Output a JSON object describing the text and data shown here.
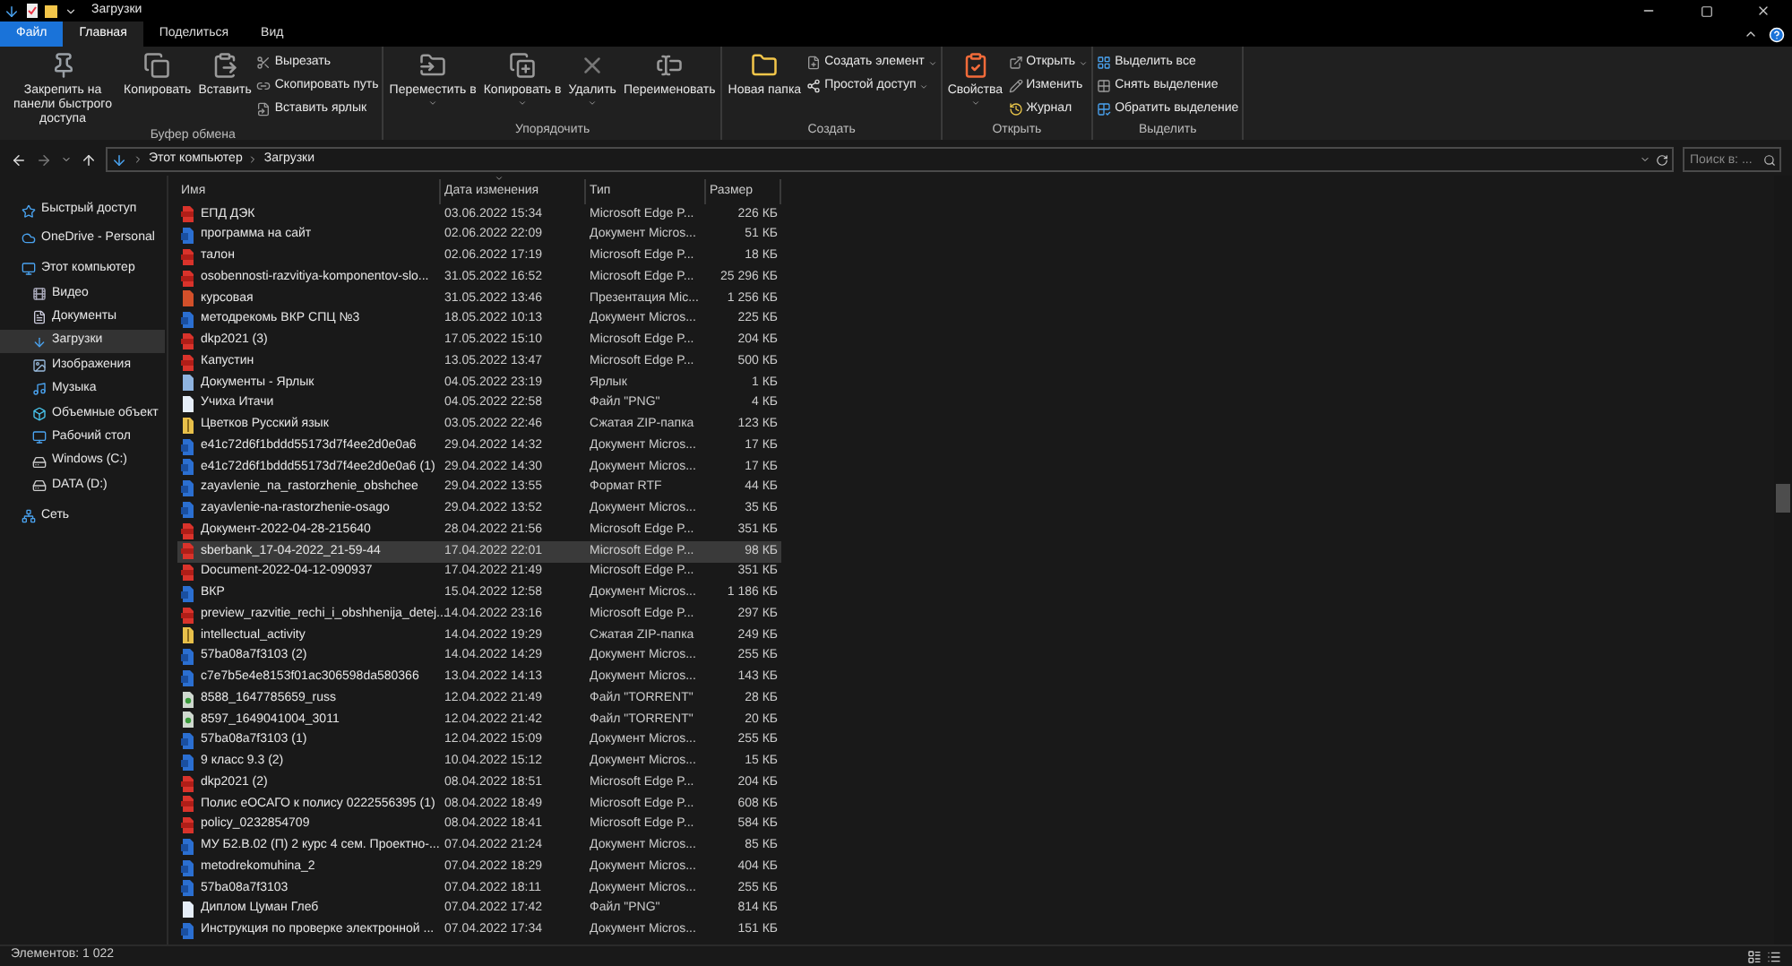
{
  "window": {
    "title": "Загрузки"
  },
  "tabs": [
    {
      "label": "Файл",
      "kind": "file",
      "selected": false
    },
    {
      "label": "Главная",
      "kind": "tab",
      "selected": true
    },
    {
      "label": "Поделиться",
      "kind": "tab",
      "selected": false
    },
    {
      "label": "Вид",
      "kind": "tab",
      "selected": false
    }
  ],
  "ribbon": [
    {
      "label": "Буфер обмена",
      "items": [
        {
          "kind": "large",
          "label": "Закрепить на панели быстрого доступа"
        },
        {
          "kind": "large",
          "label": "Копировать"
        },
        {
          "kind": "large",
          "label": "Вставить"
        },
        {
          "kind": "small",
          "label": "Вырезать"
        },
        {
          "kind": "small",
          "label": "Скопировать путь"
        },
        {
          "kind": "small",
          "label": "Вставить ярлык"
        }
      ]
    },
    {
      "label": "Упорядочить",
      "items": [
        {
          "kind": "large",
          "label": "Переместить в",
          "caret": true
        },
        {
          "kind": "large",
          "label": "Копировать в",
          "caret": true
        },
        {
          "kind": "large",
          "label": "Удалить",
          "caret": true
        },
        {
          "kind": "large",
          "label": "Переименовать"
        }
      ]
    },
    {
      "label": "Создать",
      "items": [
        {
          "kind": "large",
          "label": "Новая папка"
        },
        {
          "kind": "small",
          "label": "Создать элемент",
          "caret": true
        },
        {
          "kind": "small",
          "label": "Простой доступ",
          "caret": true
        }
      ]
    },
    {
      "label": "Открыть",
      "items": [
        {
          "kind": "large",
          "label": "Свойства",
          "caret": true
        },
        {
          "kind": "small",
          "label": "Открыть",
          "caret": true
        },
        {
          "kind": "small",
          "label": "Изменить"
        },
        {
          "kind": "small",
          "label": "Журнал"
        }
      ]
    },
    {
      "label": "Выделить",
      "items": [
        {
          "kind": "small",
          "label": "Выделить все"
        },
        {
          "kind": "small",
          "label": "Снять выделение"
        },
        {
          "kind": "small",
          "label": "Обратить выделение"
        }
      ]
    }
  ],
  "address": {
    "path": [
      "Этот компьютер",
      "Загрузки"
    ]
  },
  "search": {
    "placeholder": "Поиск в: ..."
  },
  "sidebar": {
    "items": [
      {
        "label": "Быстрый доступ",
        "selected": false
      },
      {
        "label": "OneDrive - Personal",
        "selected": false
      },
      {
        "label": "Этот компьютер",
        "selected": false,
        "children": [
          {
            "label": "Видео",
            "selected": false
          },
          {
            "label": "Документы",
            "selected": false
          },
          {
            "label": "Загрузки",
            "selected": true
          },
          {
            "label": "Изображения",
            "selected": false
          },
          {
            "label": "Музыка",
            "selected": false
          },
          {
            "label": "Объемные объект",
            "selected": false
          },
          {
            "label": "Рабочий стол",
            "selected": false
          },
          {
            "label": "Windows (C:)",
            "selected": false
          },
          {
            "label": "DATA (D:)",
            "selected": false
          }
        ]
      },
      {
        "label": "Сеть",
        "selected": false
      }
    ]
  },
  "table": {
    "columns": [
      {
        "label": "Имя",
        "sorted": false
      },
      {
        "label": "Дата изменения",
        "sorted": true
      },
      {
        "label": "Тип",
        "sorted": false
      },
      {
        "label": "Размер",
        "sorted": false
      }
    ],
    "rows": [
      {
        "name": "ЕПД ДЭК",
        "date": "03.06.2022 15:34",
        "type": "Microsoft Edge P...",
        "size": "226 КБ",
        "kind": "pdf",
        "selected": false
      },
      {
        "name": "программа на сайт",
        "date": "02.06.2022 22:09",
        "type": "Документ Micros...",
        "size": "51 КБ",
        "kind": "word",
        "selected": false
      },
      {
        "name": "талон",
        "date": "02.06.2022 17:19",
        "type": "Microsoft Edge P...",
        "size": "18 КБ",
        "kind": "pdf",
        "selected": false
      },
      {
        "name": "osobennosti-razvitiya-komponentov-slo...",
        "date": "31.05.2022 16:52",
        "type": "Microsoft Edge P...",
        "size": "25 296 КБ",
        "kind": "pdf",
        "selected": false
      },
      {
        "name": "курсовая",
        "date": "31.05.2022 13:46",
        "type": "Презентация Mic...",
        "size": "1 256 КБ",
        "kind": "ppt",
        "selected": false
      },
      {
        "name": "методрекомь ВКР СПЦ №3",
        "date": "18.05.2022 10:13",
        "type": "Документ Micros...",
        "size": "225 КБ",
        "kind": "word",
        "selected": false
      },
      {
        "name": "dkp2021 (3)",
        "date": "17.05.2022 15:10",
        "type": "Microsoft Edge P...",
        "size": "204 КБ",
        "kind": "pdf",
        "selected": false
      },
      {
        "name": "Капустин",
        "date": "13.05.2022 13:47",
        "type": "Microsoft Edge P...",
        "size": "500 КБ",
        "kind": "pdf",
        "selected": false
      },
      {
        "name": "Документы - Ярлык",
        "date": "04.05.2022 23:19",
        "type": "Ярлык",
        "size": "1 КБ",
        "kind": "shortcut",
        "selected": false
      },
      {
        "name": "Учиха Итачи",
        "date": "04.05.2022 22:58",
        "type": "Файл \"PNG\"",
        "size": "4 КБ",
        "kind": "png",
        "selected": false
      },
      {
        "name": "Цветков Русский язык",
        "date": "03.05.2022 22:46",
        "type": "Сжатая ZIP-папка",
        "size": "123 КБ",
        "kind": "zip",
        "selected": false
      },
      {
        "name": "e41c72d6f1bddd55173d7f4ee2d0e0a6",
        "date": "29.04.2022 14:32",
        "type": "Документ Micros...",
        "size": "17 КБ",
        "kind": "word",
        "selected": false
      },
      {
        "name": "e41c72d6f1bddd55173d7f4ee2d0e0a6 (1)",
        "date": "29.04.2022 14:30",
        "type": "Документ Micros...",
        "size": "17 КБ",
        "kind": "word",
        "selected": false
      },
      {
        "name": "zayavlenie_na_rastorzhenie_obshchee",
        "date": "29.04.2022 13:55",
        "type": "Формат RTF",
        "size": "44 КБ",
        "kind": "word",
        "selected": false
      },
      {
        "name": "zayavlenie-na-rastorzhenie-osago",
        "date": "29.04.2022 13:52",
        "type": "Документ Micros...",
        "size": "35 КБ",
        "kind": "word",
        "selected": false
      },
      {
        "name": "Документ-2022-04-28-215640",
        "date": "28.04.2022 21:56",
        "type": "Microsoft Edge P...",
        "size": "351 КБ",
        "kind": "pdf",
        "selected": false
      },
      {
        "name": "sberbank_17-04-2022_21-59-44",
        "date": "17.04.2022 22:01",
        "type": "Microsoft Edge P...",
        "size": "98 КБ",
        "kind": "pdf",
        "selected": true
      },
      {
        "name": "Document-2022-04-12-090937",
        "date": "17.04.2022 21:49",
        "type": "Microsoft Edge P...",
        "size": "351 КБ",
        "kind": "pdf",
        "selected": false
      },
      {
        "name": "ВКР",
        "date": "15.04.2022 12:58",
        "type": "Документ Micros...",
        "size": "1 186 КБ",
        "kind": "word",
        "selected": false
      },
      {
        "name": "preview_razvitie_rechi_i_obshhenija_detej...",
        "date": "14.04.2022 23:16",
        "type": "Microsoft Edge P...",
        "size": "297 КБ",
        "kind": "pdf",
        "selected": false
      },
      {
        "name": "intellectual_activity",
        "date": "14.04.2022 19:29",
        "type": "Сжатая ZIP-папка",
        "size": "249 КБ",
        "kind": "zip",
        "selected": false
      },
      {
        "name": "57ba08a7f3103 (2)",
        "date": "14.04.2022 14:29",
        "type": "Документ Micros...",
        "size": "255 КБ",
        "kind": "word",
        "selected": false
      },
      {
        "name": "c7e7b5e4e8153f01ac306598da580366",
        "date": "13.04.2022 14:13",
        "type": "Документ Micros...",
        "size": "143 КБ",
        "kind": "word",
        "selected": false
      },
      {
        "name": "8588_1647785659_russ",
        "date": "12.04.2022 21:49",
        "type": "Файл \"TORRENT\"",
        "size": "28 КБ",
        "kind": "torrent",
        "selected": false
      },
      {
        "name": "8597_1649041004_3011",
        "date": "12.04.2022 21:42",
        "type": "Файл \"TORRENT\"",
        "size": "20 КБ",
        "kind": "torrent",
        "selected": false
      },
      {
        "name": "57ba08a7f3103 (1)",
        "date": "12.04.2022 15:09",
        "type": "Документ Micros...",
        "size": "255 КБ",
        "kind": "word",
        "selected": false
      },
      {
        "name": "9 класс 9.3 (2)",
        "date": "10.04.2022 15:12",
        "type": "Документ Micros...",
        "size": "15 КБ",
        "kind": "word",
        "selected": false
      },
      {
        "name": "dkp2021 (2)",
        "date": "08.04.2022 18:51",
        "type": "Microsoft Edge P...",
        "size": "204 КБ",
        "kind": "pdf",
        "selected": false
      },
      {
        "name": "Полис еОСАГО к полису 0222556395 (1)",
        "date": "08.04.2022 18:49",
        "type": "Microsoft Edge P...",
        "size": "608 КБ",
        "kind": "pdf",
        "selected": false
      },
      {
        "name": "policy_0232854709",
        "date": "08.04.2022 18:41",
        "type": "Microsoft Edge P...",
        "size": "584 КБ",
        "kind": "pdf",
        "selected": false
      },
      {
        "name": "МУ Б2.В.02 (П) 2 курс 4 сем. Проектно-...",
        "date": "07.04.2022 21:24",
        "type": "Документ Micros...",
        "size": "85 КБ",
        "kind": "word",
        "selected": false
      },
      {
        "name": "metodrekomuhina_2",
        "date": "07.04.2022 18:29",
        "type": "Документ Micros...",
        "size": "404 КБ",
        "kind": "word",
        "selected": false
      },
      {
        "name": "57ba08a7f3103",
        "date": "07.04.2022 18:11",
        "type": "Документ Micros...",
        "size": "255 КБ",
        "kind": "word",
        "selected": false
      },
      {
        "name": "Диплом Цуман Глеб",
        "date": "07.04.2022 17:42",
        "type": "Файл \"PNG\"",
        "size": "814 КБ",
        "kind": "png",
        "selected": false
      },
      {
        "name": "Инструкция по проверке электронной ...",
        "date": "07.04.2022 17:34",
        "type": "Документ Micros...",
        "size": "151 КБ",
        "kind": "word",
        "selected": false
      }
    ]
  },
  "status_bar": {
    "count": "Элементов: 1 022"
  }
}
